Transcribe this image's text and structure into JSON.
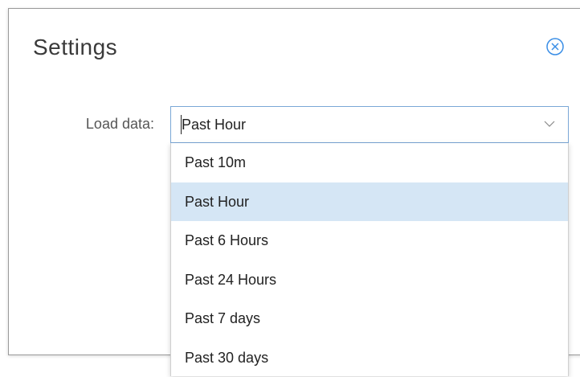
{
  "dialog": {
    "title": "Settings",
    "close_icon": "close-circle-icon"
  },
  "load_data": {
    "label": "Load data:",
    "selected_value": "Past Hour",
    "options": [
      {
        "label": "Past 10m",
        "selected": false
      },
      {
        "label": "Past Hour",
        "selected": true
      },
      {
        "label": "Past 6 Hours",
        "selected": false
      },
      {
        "label": "Past 24 Hours",
        "selected": false
      },
      {
        "label": "Past 7 days",
        "selected": false
      },
      {
        "label": "Past 30 days",
        "selected": false
      }
    ]
  },
  "colors": {
    "accent": "#3a8ee6",
    "selected_option_bg": "#d5e6f5",
    "select_border": "#7aa7d6"
  }
}
